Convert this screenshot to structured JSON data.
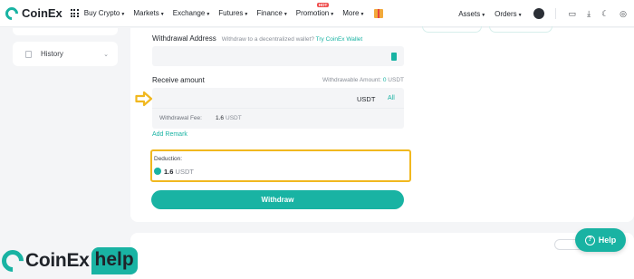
{
  "nav": {
    "brand": "CoinEx",
    "menu": [
      {
        "label": "Buy Crypto"
      },
      {
        "label": "Markets"
      },
      {
        "label": "Exchange"
      },
      {
        "label": "Futures"
      },
      {
        "label": "Finance"
      },
      {
        "label": "Promotion",
        "badge": "HOT"
      },
      {
        "label": "More"
      }
    ],
    "right_menu": [
      {
        "label": "Assets"
      },
      {
        "label": "Orders"
      }
    ],
    "icons": [
      "grid-icon",
      "gift-icon",
      "avatar",
      "message-icon",
      "download-icon",
      "moon-icon",
      "globe-icon"
    ]
  },
  "sidebar": {
    "history_label": "History"
  },
  "form": {
    "withdrawal_address": {
      "label": "Withdrawal Address",
      "hint": "Withdraw to a decentralized wallet?",
      "hint_link": "Try CoinEx Wallet"
    },
    "receive_amount": {
      "label": "Receive amount",
      "withdrawable_label": "Withdrawable Amount:",
      "withdrawable_value": "0",
      "withdrawable_unit": "USDT",
      "currency": "USDT",
      "all_label": "All",
      "fee_label": "Withdrawal Fee:",
      "fee_value": "1.6",
      "fee_unit": "USDT"
    },
    "add_remark": "Add Remark",
    "deduction": {
      "label": "Deduction:",
      "value": "1.6",
      "unit": "USDT"
    },
    "withdraw_button": "Withdraw"
  },
  "help_button": "Help",
  "watermark": {
    "brand": "CoinEx",
    "tag": "help"
  },
  "colors": {
    "accent": "#19b3a3",
    "highlight": "#f1b81f",
    "background": "#f4f5f7"
  }
}
